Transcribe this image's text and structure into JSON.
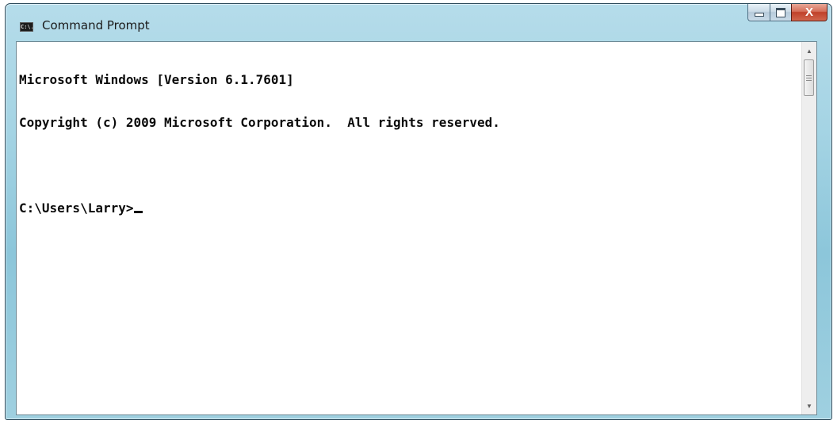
{
  "window": {
    "title": "Command Prompt",
    "app_icon_text": "C:\\.",
    "caption": {
      "minimize_icon": "minimize-icon",
      "maximize_icon": "maximize-icon",
      "close_symbol": "X"
    }
  },
  "console": {
    "lines": [
      "Microsoft Windows [Version 6.1.7601]",
      "Copyright (c) 2009 Microsoft Corporation.  All rights reserved.",
      "",
      "C:\\Users\\Larry>"
    ]
  },
  "scrollbar": {
    "up_arrow": "▲",
    "down_arrow": "▼"
  },
  "colors": {
    "frame": "#a5d4e4",
    "close_button": "#c0412a",
    "console_background": "#ffffff",
    "console_text": "#0a0a0a"
  }
}
